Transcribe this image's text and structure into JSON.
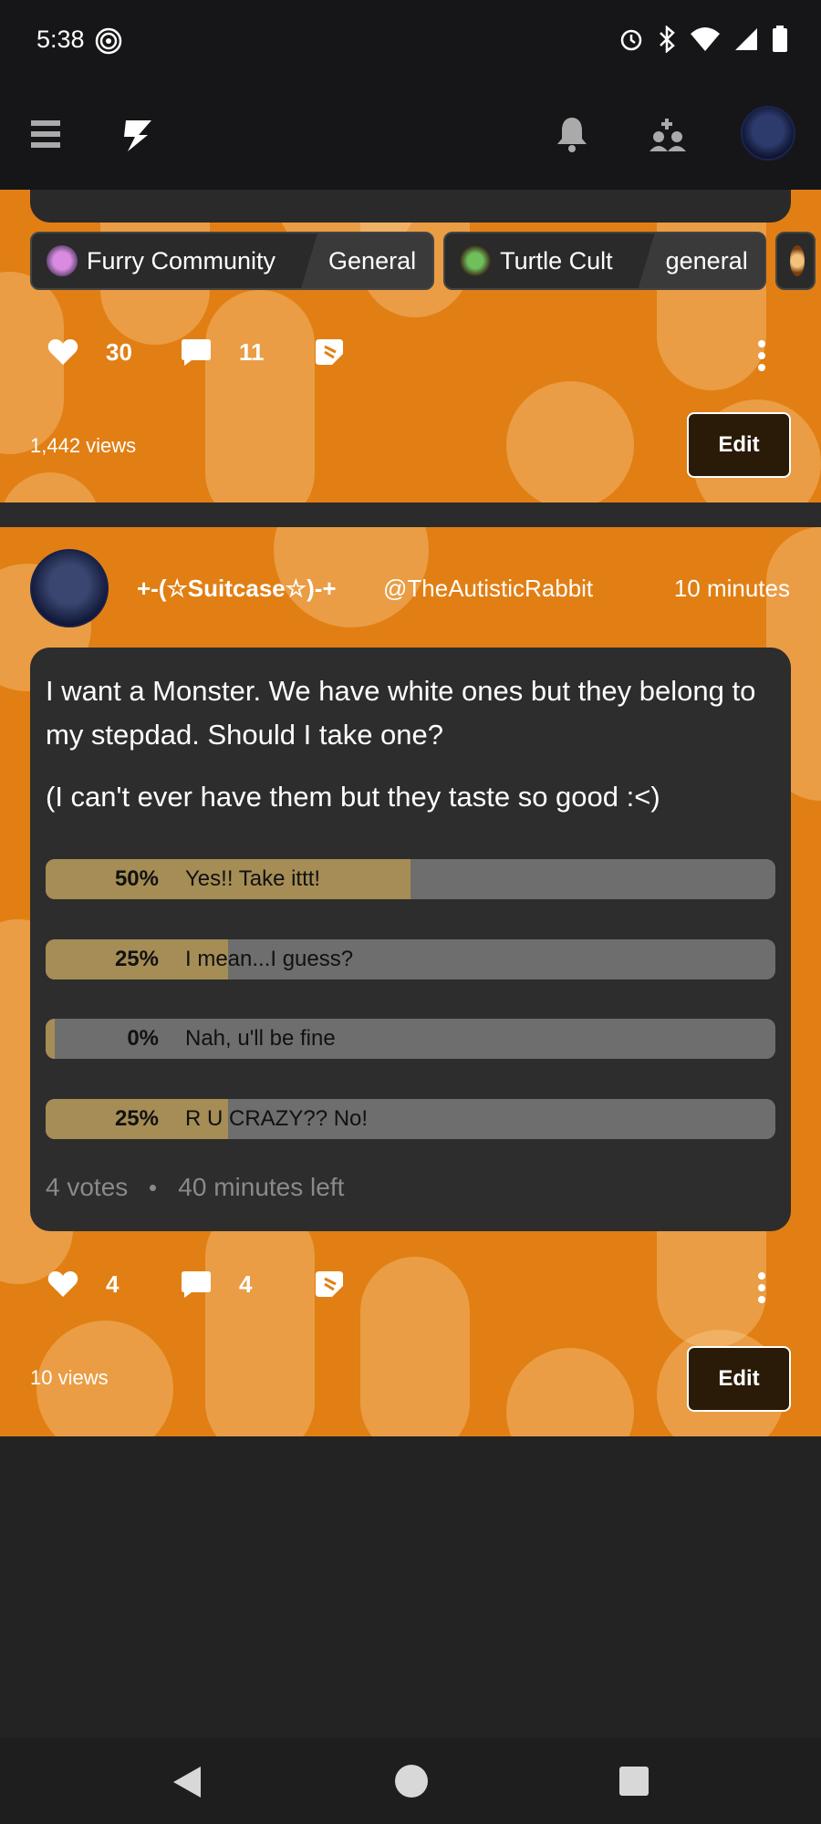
{
  "status_bar": {
    "time": "5:38"
  },
  "post1": {
    "tags": [
      {
        "name": "Furry Community",
        "sub": "General"
      },
      {
        "name": "Turtle Cult",
        "sub": "general"
      }
    ],
    "likes": "30",
    "comments": "11",
    "views": "1,442 views",
    "edit_label": "Edit"
  },
  "post2": {
    "display_name": "+-(☆Suitcase☆)-+",
    "handle": "@TheAutisticRabbit",
    "time": "10 minutes",
    "question_line1": "I want a Monster. We have white ones but they belong to my stepdad. Should I take one?",
    "question_line2": "(I can't ever have them but they taste so good :<)",
    "poll": [
      {
        "percent": "50%",
        "fraction": 0.5,
        "label": "Yes!! Take ittt!"
      },
      {
        "percent": "25%",
        "fraction": 0.25,
        "label": "I mean...I guess?"
      },
      {
        "percent": "0%",
        "fraction": 0.0,
        "label": "Nah, u'll be fine"
      },
      {
        "percent": "25%",
        "fraction": 0.25,
        "label": "R U CRAZY?? No!"
      }
    ],
    "votes": "4 votes",
    "time_left": "40 minutes left",
    "likes": "4",
    "comments": "4",
    "views": "10 views",
    "edit_label": "Edit"
  },
  "colors": {
    "accent_orange": "#e17f14",
    "poll_fill": "#a58d55",
    "card_bg": "#2d2d2d"
  },
  "icons": [
    "menu-icon",
    "bolt-logo-icon",
    "bell-icon",
    "people-icon",
    "heart-icon",
    "comment-icon",
    "share-icon",
    "more-icon"
  ]
}
